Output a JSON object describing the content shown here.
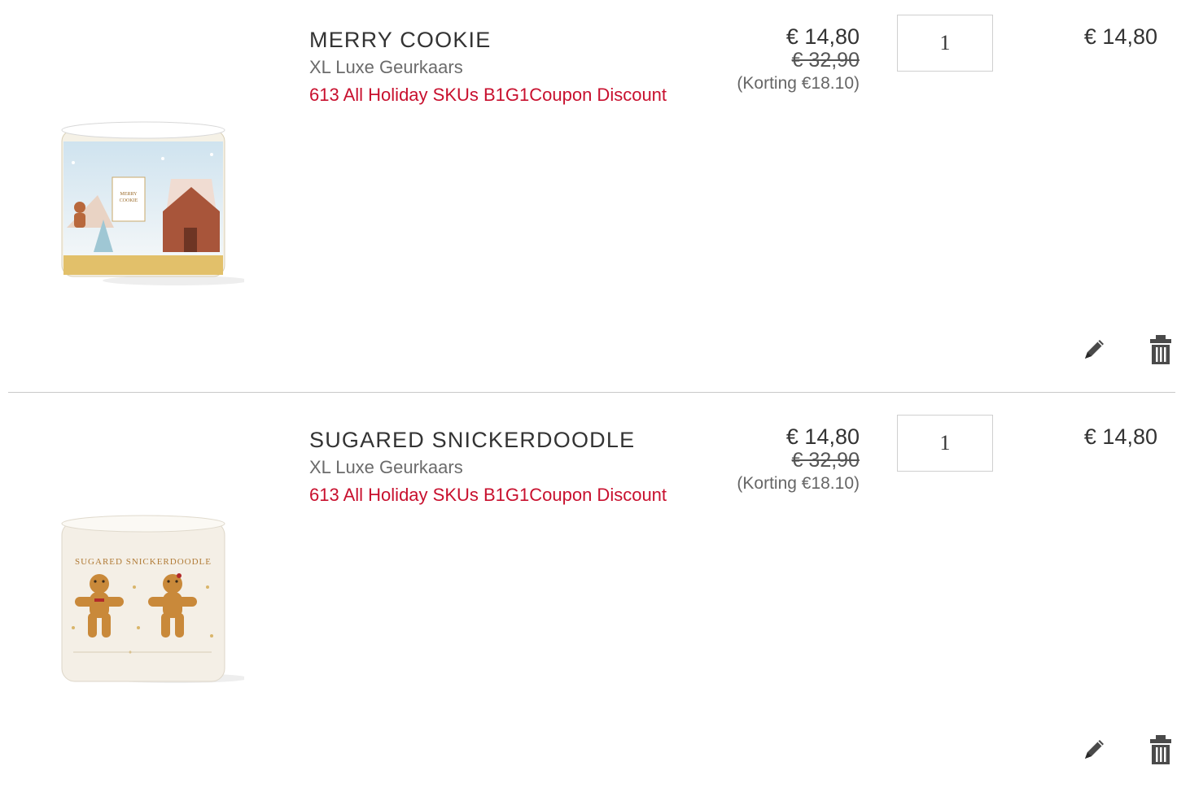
{
  "items": [
    {
      "name": "MERRY COOKIE",
      "subtitle": "XL Luxe Geurkaars",
      "promo": "613 All Holiday SKUs B1G1Coupon Discount",
      "price_now": "€ 14,80",
      "price_was": "€ 32,90",
      "discount": "(Korting €18.10)",
      "quantity": "1",
      "line_total": "€ 14,80",
      "label_text": "MERRY COOKIE"
    },
    {
      "name": "SUGARED SNICKERDOODLE",
      "subtitle": "XL Luxe Geurkaars",
      "promo": "613 All Holiday SKUs B1G1Coupon Discount",
      "price_now": "€ 14,80",
      "price_was": "€ 32,90",
      "discount": "(Korting €18.10)",
      "quantity": "1",
      "line_total": "€ 14,80",
      "label_text": "SUGARED SNICKERDOODLE"
    }
  ],
  "icons": {
    "edit": "pencil-icon",
    "delete": "trash-icon"
  },
  "colors": {
    "promo": "#c8102e",
    "text": "#333333",
    "muted": "#6b6b6b",
    "divider": "#c9c9c9"
  }
}
